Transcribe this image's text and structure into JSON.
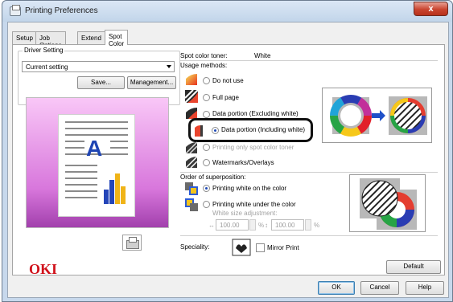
{
  "window": {
    "title": "Printing Preferences",
    "close_label": "x"
  },
  "tabs": [
    {
      "label": "Setup"
    },
    {
      "label": "Job Options"
    },
    {
      "label": "Extend"
    },
    {
      "label": "Spot Color"
    }
  ],
  "driver_setting": {
    "group_label": "Driver Setting",
    "selected": "Current setting",
    "save_label": "Save...",
    "management_label": "Management..."
  },
  "preview": {
    "letter": "A"
  },
  "brand": {
    "logo_text": "OKI"
  },
  "spot_color": {
    "toner_label": "Spot color toner:",
    "toner_value": "White",
    "usage_label": "Usage methods:",
    "usage_methods": [
      {
        "label": "Do not use",
        "selected": false
      },
      {
        "label": "Full page",
        "selected": false
      },
      {
        "label": "Data portion (Excluding white)",
        "selected": false
      },
      {
        "label": "Data portion (Including white)",
        "selected": true
      },
      {
        "label": "Printing only spot color toner",
        "selected": false
      },
      {
        "label": "Watermarks/Overlays",
        "selected": false
      }
    ],
    "order_label": "Order of superposition:",
    "order_options": [
      {
        "label": "Printing white on the color",
        "selected": true
      },
      {
        "label": "Printing white under the color",
        "selected": false
      }
    ],
    "white_size_label": "White size adjustment:",
    "spin_x_value": "100.00",
    "spin_x_unit": "%",
    "spin_y_value": "100.00",
    "spin_y_unit": "%",
    "speciality_label": "Speciality:",
    "mirror_print_label": "Mirror Print",
    "mirror_print_checked": false
  },
  "buttons": {
    "default_label": "Default",
    "ok_label": "OK",
    "cancel_label": "Cancel",
    "help_label": "Help"
  },
  "colors": {
    "accent_blue": "#1f45b3",
    "oki_red": "#d0121b",
    "preview_pink": "#d877dc"
  }
}
